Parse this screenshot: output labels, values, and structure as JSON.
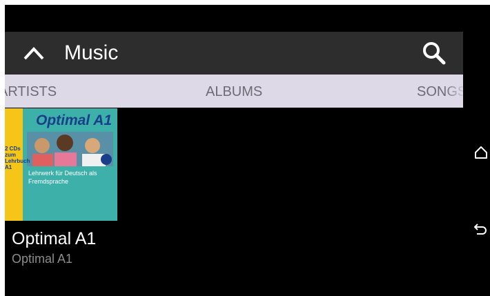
{
  "toolbar": {
    "up_icon": "chevron-up-icon",
    "title": "Music",
    "search_icon": "search-icon"
  },
  "tabs": [
    {
      "label": "ARTISTS"
    },
    {
      "label": "ALBUMS"
    },
    {
      "label": "SONGS"
    }
  ],
  "albums": [
    {
      "name": "Optimal A1",
      "artist": "Optimal A1",
      "cover_text": "Optimal A1",
      "cover_subtitle": "Lehrwerk für Deutsch als Fremdsprache",
      "cover_badge": "2 CDs zum Lehrbuch A1"
    }
  ],
  "nav": {
    "home_icon": "home-icon",
    "back_icon": "back-icon"
  },
  "colors": {
    "background": "#000000",
    "toolbar": "#2d2d2d",
    "tab_bar": "#ddd9e7",
    "tab_text": "#6e6b75"
  }
}
